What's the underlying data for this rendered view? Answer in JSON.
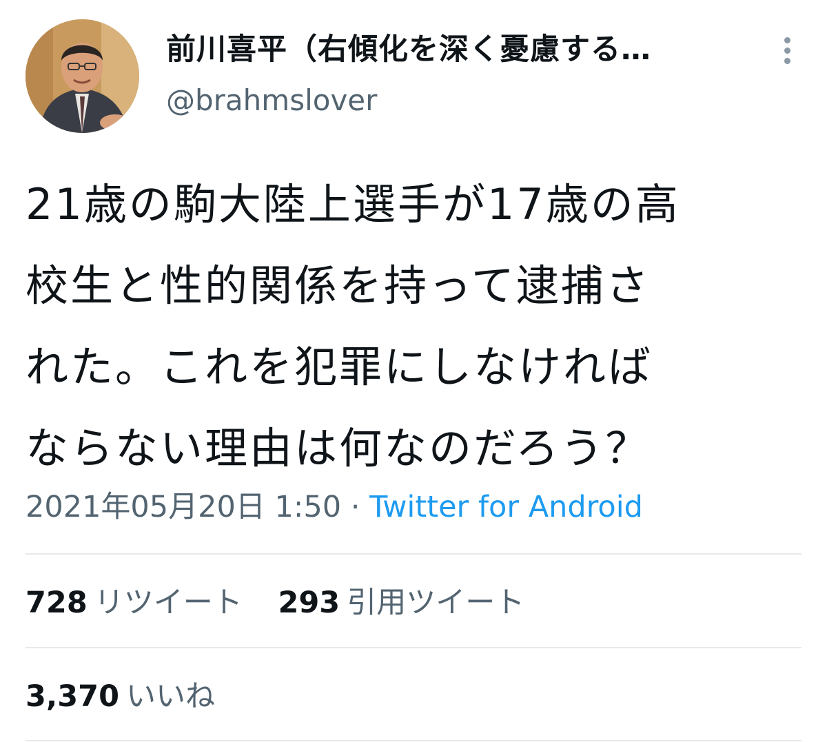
{
  "author": {
    "display_name": "前川喜平（右傾化を深く憂慮する…",
    "handle": "@brahmslover",
    "avatar": "profile-photo"
  },
  "tweet": {
    "text": "21歳の駒大陸上選手が17歳の高\n校生と性的関係を持って逮捕さ\nれた。これを犯罪にしなければ\nならない理由は何なのだろう？",
    "timestamp": "2021年05月20日 1:50",
    "separator": " · ",
    "source": "Twitter for Android"
  },
  "stats": {
    "retweets_count": "728",
    "retweets_label": "リツイート",
    "quotes_count": "293",
    "quotes_label": "引用ツイート",
    "likes_count": "3,370",
    "likes_label": "いいね"
  },
  "colors": {
    "link": "#1d9bf0",
    "secondary_text": "#536471",
    "primary_text": "#0f1419",
    "divider": "#e6e9ec"
  },
  "icons": {
    "more": "more-vertical-icon"
  }
}
